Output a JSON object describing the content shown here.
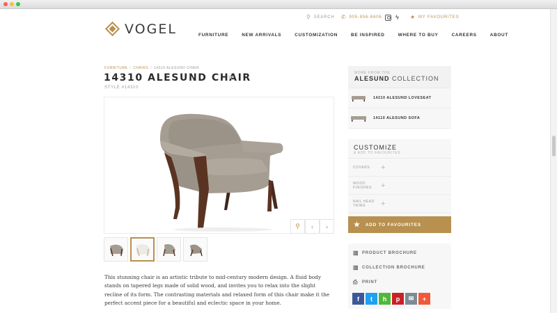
{
  "brand": {
    "name": "VOGEL"
  },
  "utility": {
    "search_label": "SEARCH",
    "phone": "905-856-6606",
    "favourites_label": "MY FAVOURITES"
  },
  "nav": [
    "FURNITURE",
    "NEW ARRIVALS",
    "CUSTOMIZATION",
    "BE INSPIRED",
    "WHERE TO BUY",
    "CAREERS",
    "ABOUT"
  ],
  "breadcrumb": {
    "level1": "FURNITURE",
    "level2": "CHAIRS",
    "current": "14310 ALESUND CHAIR"
  },
  "product": {
    "title": "14310 ALESUND CHAIR",
    "style_label": "STYLE",
    "style_number": "#14310",
    "description": "This stunning chair is an artistic tribute to mid-century modern design. A fluid body stands on tapered legs made of solid wood, and invites you to relax into the slight recline of its form. The contrasting materials and relaxed form of this chair make it the perfect accent piece for a beautiful and eclectic space in your home."
  },
  "collection": {
    "small_label": "MORE FROM THE",
    "name": "ALESUND",
    "suffix": "COLLECTION",
    "items": [
      {
        "label": "14210 ALESUND LOVESEAT"
      },
      {
        "label": "14110 ALESUND SOFA"
      }
    ]
  },
  "customize": {
    "title": "CUSTOMIZE",
    "subtitle": "& ADD TO FAVOURITES",
    "options": [
      {
        "line1": "COVERS",
        "line2": ""
      },
      {
        "line1": "WOOD",
        "line2": "FINISHES"
      },
      {
        "line1": "NAIL HEAD",
        "line2": "TRIMS"
      }
    ],
    "add_button": "ADD TO FAVOURITES"
  },
  "downloads": [
    {
      "label": "PRODUCT BROCHURE",
      "icon": "book-icon"
    },
    {
      "label": "COLLECTION BROCHURE",
      "icon": "book-icon"
    },
    {
      "label": "PRINT",
      "icon": "printer-icon"
    }
  ],
  "share": [
    {
      "glyph": "f",
      "color": "#3b5998",
      "icon": "facebook-icon"
    },
    {
      "glyph": "t",
      "color": "#1da1f2",
      "icon": "twitter-icon"
    },
    {
      "glyph": "h",
      "color": "#4fb93c",
      "icon": "houzz-icon"
    },
    {
      "glyph": "p",
      "color": "#cb2027",
      "icon": "pinterest-icon"
    },
    {
      "glyph": "✉",
      "color": "#7d8b93",
      "icon": "email-icon"
    },
    {
      "glyph": "+",
      "color": "#f05a38",
      "icon": "more-share-icon"
    }
  ],
  "colors": {
    "accent": "#b8904f"
  }
}
